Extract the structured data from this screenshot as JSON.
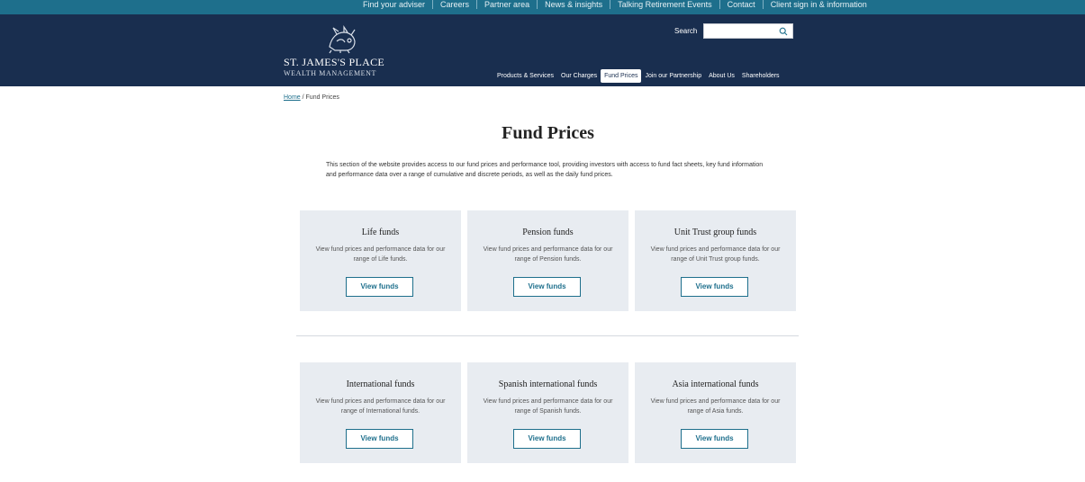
{
  "top_links": [
    "Find your adviser",
    "Careers",
    "Partner area",
    "News & insights",
    "Talking Retirement Events",
    "Contact",
    "Client sign in & information"
  ],
  "logo": {
    "name": "ST. JAMES'S PLACE",
    "sub": "WEALTH MANAGEMENT"
  },
  "search": {
    "label": "Search",
    "value": ""
  },
  "main_nav": [
    {
      "label": "Products & Services",
      "active": false
    },
    {
      "label": "Our Charges",
      "active": false
    },
    {
      "label": "Fund Prices",
      "active": true
    },
    {
      "label": "Join our Partnership",
      "active": false
    },
    {
      "label": "About Us",
      "active": false
    },
    {
      "label": "Shareholders",
      "active": false
    }
  ],
  "breadcrumb": {
    "home": "Home",
    "separator": " / ",
    "current": "Fund Prices"
  },
  "page": {
    "title": "Fund Prices",
    "intro": "This section of the website provides access to our fund prices and performance tool, providing investors with access to fund fact sheets, key fund information and performance data over a range of cumulative and discrete periods, as well as the daily fund prices."
  },
  "cards": [
    {
      "title": "Life funds",
      "text": "View fund prices and performance data for our range of Life funds.",
      "button": "View funds"
    },
    {
      "title": "Pension funds",
      "text": "View fund prices and performance data for our range of Pension funds.",
      "button": "View funds"
    },
    {
      "title": "Unit Trust group funds",
      "text": "View fund prices and performance data for our range of Unit Trust group funds.",
      "button": "View funds"
    },
    {
      "title": "International funds",
      "text": "View fund prices and performance data for our range of International funds.",
      "button": "View funds"
    },
    {
      "title": "Spanish international funds",
      "text": "View fund prices and performance data for our range of Spanish funds.",
      "button": "View funds"
    },
    {
      "title": "Asia international funds",
      "text": "View fund prices and performance data for our range of Asia funds.",
      "button": "View funds"
    }
  ],
  "colors": {
    "top_strip": "#1e6f8c",
    "header": "#192e4f",
    "card_bg": "#e8ecf1",
    "accent": "#1e6f8c"
  }
}
